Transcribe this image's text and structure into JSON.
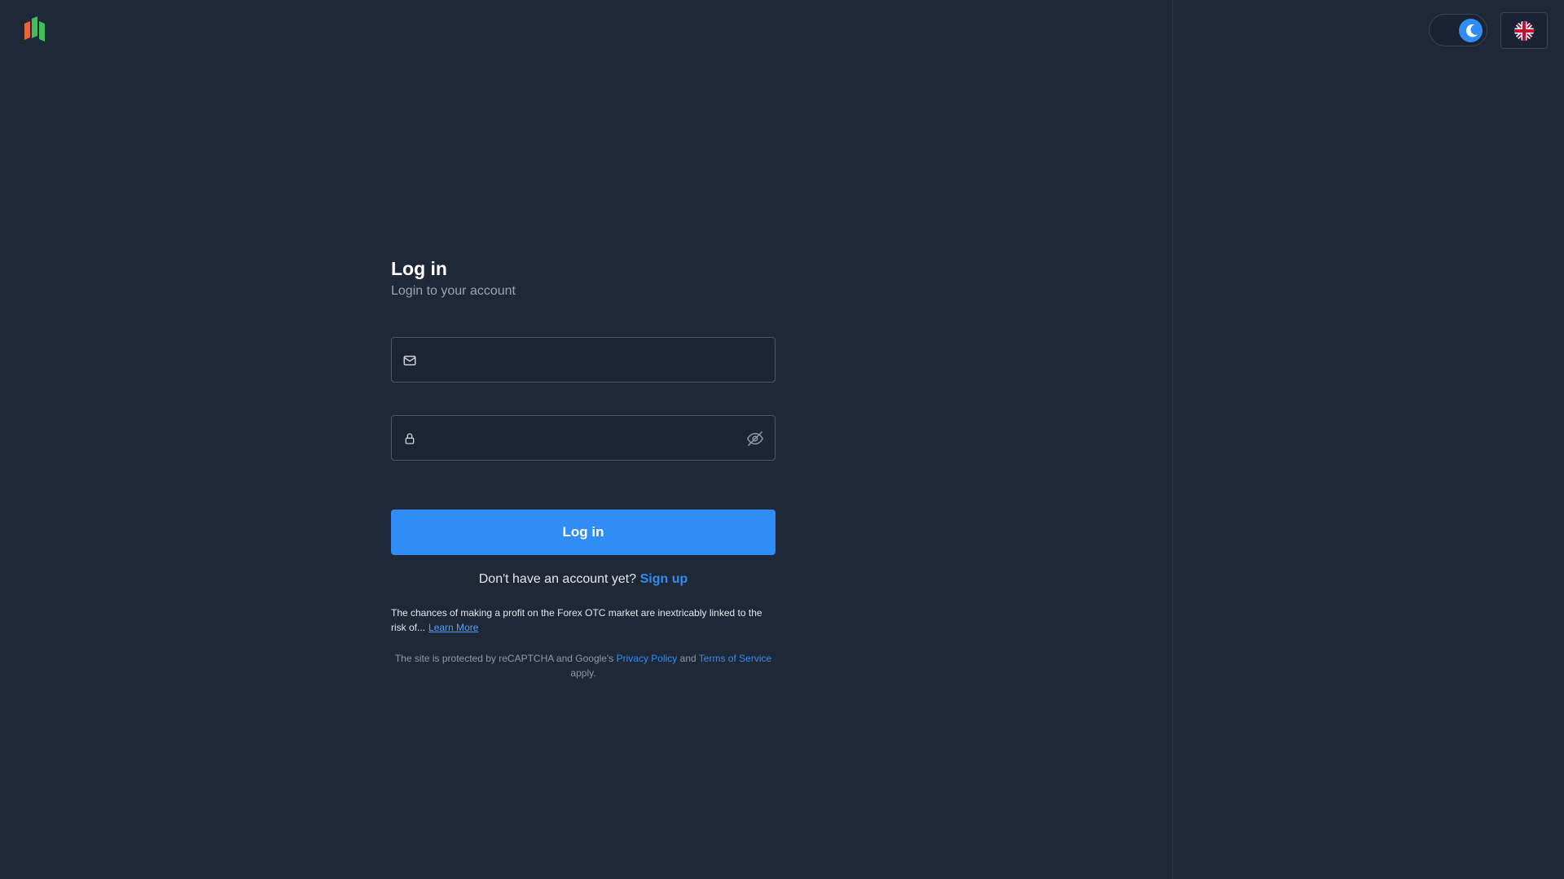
{
  "header": {
    "logo_icon": "trading-bars-logo",
    "theme_toggle": {
      "icon": "moon-icon",
      "state": "dark"
    },
    "language": {
      "icon": "uk-flag-icon"
    }
  },
  "form": {
    "title": "Log in",
    "subtitle": "Login to your account",
    "email": {
      "icon": "mail-icon",
      "value": "",
      "placeholder": ""
    },
    "password": {
      "icon": "lock-icon",
      "value": "",
      "placeholder": "",
      "toggle_icon": "eye-off-icon"
    },
    "submit_label": "Log in",
    "signup_prompt": "Don't have an account yet?",
    "signup_link": "Sign up"
  },
  "disclaimer": {
    "text": "The chances of making a profit on the Forex OTC market are inextricably linked to the risk of...",
    "learn_more": "Learn More"
  },
  "recaptcha": {
    "prefix": "The site is protected by reCAPTCHA and Google's",
    "privacy_link": "Privacy Policy",
    "and": "and",
    "terms_link": "Terms of Service",
    "suffix": "apply."
  },
  "colors": {
    "background": "#1e2837",
    "accent": "#2f8df5",
    "logo_orange": "#e8623a",
    "logo_green": "#3fbf5a"
  }
}
